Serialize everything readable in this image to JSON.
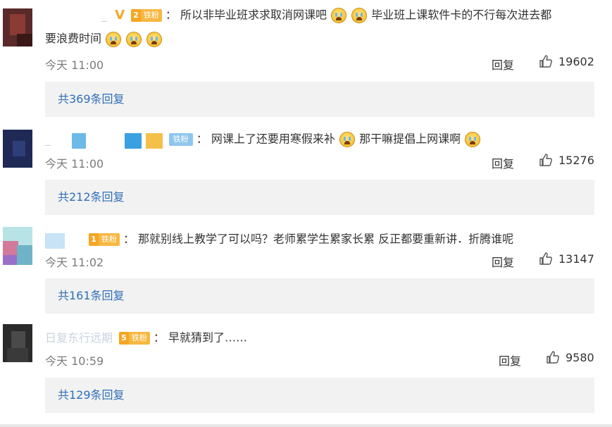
{
  "comments": [
    {
      "nickname": "_",
      "badge_level": "2",
      "badge_text": "铁粉",
      "colon": "：",
      "text_line1": "所以非毕业班求求取消网课吧",
      "text_line1b": "毕业班上课软件卡的不行每次进去都",
      "text_line2": "要浪费时间",
      "time": "今天 11:00",
      "reply_label": "回复",
      "likes": "19602",
      "replies_link": "共369条回复"
    },
    {
      "nickname": "_",
      "badge_text": "铁粉",
      "colon": "：",
      "text_line1": "网课上了还要用寒假来补",
      "text_line1b": "那干嘛提倡上网课啊",
      "time": "今天 11:00",
      "reply_label": "回复",
      "likes": "15276",
      "replies_link": "共212条回复"
    },
    {
      "badge_level": "1",
      "badge_text": "铁粉",
      "colon": "：",
      "text_line1": "那就别线上教学了可以吗？老师累学生累家长累 反正都要重新讲．折腾谁呢",
      "time": "今天 11:02",
      "reply_label": "回复",
      "likes": "13147",
      "replies_link": "共161条回复"
    },
    {
      "nickname": "日复东行远期",
      "badge_level": "5",
      "badge_text": "铁粉",
      "colon": "：",
      "text_line1": "早就猜到了……",
      "time": "今天 10:59",
      "reply_label": "回复",
      "likes": "9580",
      "replies_link": "共129条回复"
    }
  ],
  "colors": {
    "link": "#2f6fb7",
    "badge_gold": "#f5a623",
    "badge_blue": "#8fc6ec",
    "reply_bg": "#f2f2f2"
  },
  "icons": {
    "like": "thumbs-up-icon",
    "emoji": "crying-face-emoji-icon"
  }
}
